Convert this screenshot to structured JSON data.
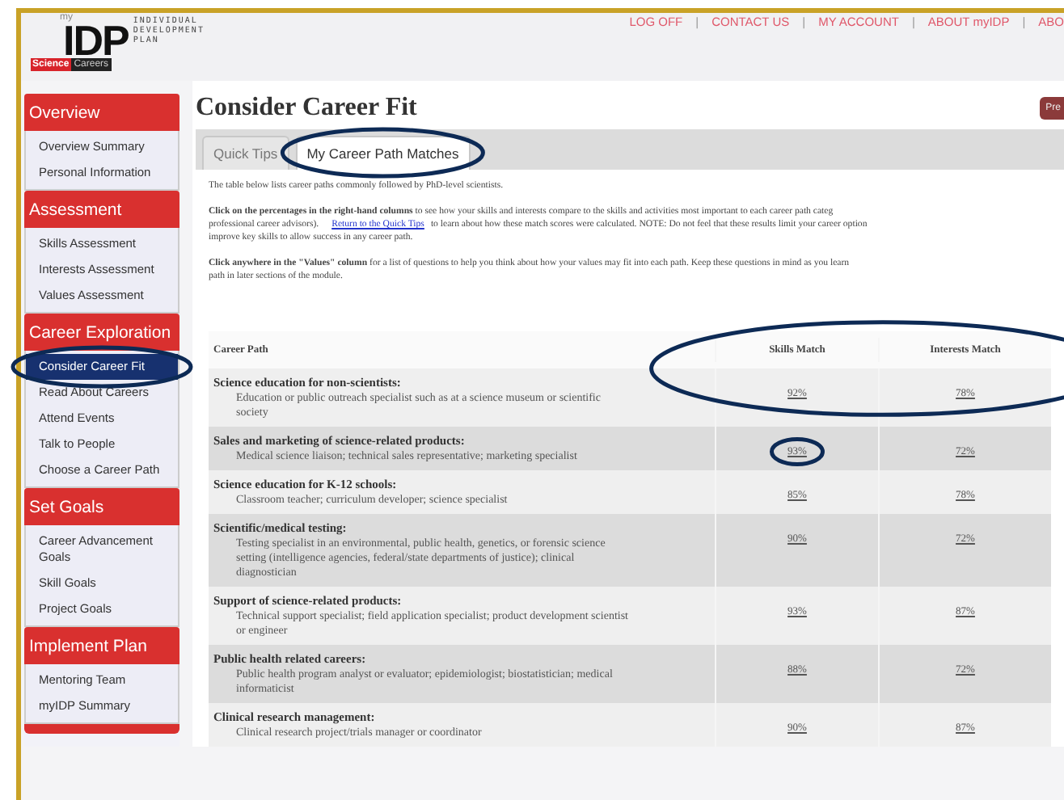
{
  "top_links": [
    {
      "kind": "link",
      "text": "LOG OFF"
    },
    {
      "kind": "separator",
      "text": "|"
    },
    {
      "kind": "link",
      "text": "CONTACT US"
    },
    {
      "kind": "separator",
      "text": "|"
    },
    {
      "kind": "link",
      "text": "MY ACCOUNT"
    },
    {
      "kind": "separator",
      "text": "|"
    },
    {
      "kind": "link",
      "text": "ABOUT myIDP"
    },
    {
      "kind": "separator",
      "text": "|"
    },
    {
      "kind": "link",
      "text": "ABO"
    }
  ],
  "logo": {
    "my": "my",
    "idp": "IDP",
    "tagline": [
      "INDIVIDUAL",
      "DEVELOPMENT",
      "PLAN"
    ],
    "brand_a": "Science",
    "brand_b": "Careers"
  },
  "sidebar": [
    {
      "heading": "Overview",
      "items": [
        {
          "label": "Overview Summary",
          "selected": false
        },
        {
          "label": "Personal Information",
          "selected": false
        }
      ]
    },
    {
      "heading": "Assessment",
      "items": [
        {
          "label": "Skills Assessment",
          "selected": false
        },
        {
          "label": "Interests Assessment",
          "selected": false
        },
        {
          "label": "Values Assessment",
          "selected": false
        }
      ]
    },
    {
      "heading": "Career Exploration",
      "items": [
        {
          "label": "Consider Career Fit",
          "selected": true
        },
        {
          "label": "Read About Careers",
          "selected": false
        },
        {
          "label": "Attend Events",
          "selected": false
        },
        {
          "label": "Talk to People",
          "selected": false
        },
        {
          "label": "Choose a Career Path",
          "selected": false
        }
      ]
    },
    {
      "heading": "Set Goals",
      "items": [
        {
          "label": "Career Advancement Goals",
          "selected": false
        },
        {
          "label": "Skill Goals",
          "selected": false
        },
        {
          "label": "Project Goals",
          "selected": false
        }
      ]
    },
    {
      "heading": "Implement Plan",
      "items": [
        {
          "label": "Mentoring Team",
          "selected": false
        },
        {
          "label": "myIDP Summary",
          "selected": false
        }
      ]
    }
  ],
  "page_title": "Consider Career Fit",
  "prev_button": "Pre",
  "tabs": [
    {
      "label": "Quick Tips",
      "selected": false
    },
    {
      "label": "My Career Path Matches",
      "selected": true
    }
  ],
  "intro": "The table below lists career paths commonly followed by PhD-level scientists.",
  "instructions": [
    [
      "**Click on the percentages in the right-hand columns** to see how your skills and interests compare to the skills and activities most important to each career path categ",
      "professional career advisors).",
      {
        "link": "Return to the Quick Tips"
      },
      "to learn about how these match scores were calculated.  NOTE: Do not feel that these results limit your career option",
      "improve key skills to allow success in any career path."
    ],
    [
      "**Click anywhere in the \"Values\" column** for a list of questions to help you think about how your values may fit into each path. Keep these questions in mind as you learn",
      "path in later sections of the module."
    ]
  ],
  "table": {
    "columns": [
      "Career Path",
      "Skills Match",
      "Interests Match"
    ],
    "rows": [
      {
        "title": "Science education for non-scientists:",
        "examples": "Education or public outreach specialist such as at a science museum or scientific society",
        "skills": "92%",
        "interests": "78%"
      },
      {
        "title": "Sales and marketing of science-related products:",
        "examples": "Medical science liaison; technical sales representative; marketing specialist",
        "skills": "93%",
        "interests": "72%"
      },
      {
        "title": "Science education for K-12 schools:",
        "examples": "Classroom teacher; curriculum developer; science specialist",
        "skills": "85%",
        "interests": "78%"
      },
      {
        "title": "Scientific/medical testing:",
        "examples": "Testing specialist in an environmental, public health, genetics, or forensic science setting (intelligence agencies, federal/state departments of justice); clinical diagnostician",
        "skills": "90%",
        "interests": "72%"
      },
      {
        "title": "Support of science-related products:",
        "examples": "Technical support specialist; field application specialist; product development scientist or engineer",
        "skills": "93%",
        "interests": "87%"
      },
      {
        "title": "Public health related careers:",
        "examples": "Public health program analyst or evaluator; epidemiologist; biostatistician; medical informaticist",
        "skills": "88%",
        "interests": "72%"
      },
      {
        "title": "Clinical research management:",
        "examples": "Clinical research project/trials manager or coordinator",
        "skills": "90%",
        "interests": "87%"
      }
    ]
  }
}
